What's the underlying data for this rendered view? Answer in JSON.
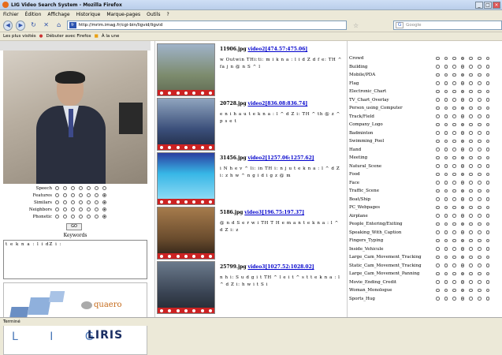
{
  "window": {
    "title": "LIG Video Search System - Mozilla Firefox"
  },
  "menu": [
    "Fichier",
    "Édition",
    "Affichage",
    "Historique",
    "Marque-pages",
    "Outils",
    "?"
  ],
  "nav": {
    "url": "http://mrim.imag.fr/cgi-bin/ligvid/ligvid",
    "search_placeholder": "Google"
  },
  "bookmarks": [
    "Les plus visités",
    "Débuter avec Firefox",
    "À la une"
  ],
  "left": {
    "modes": [
      {
        "label": "Speech",
        "sel": -1
      },
      {
        "label": "Features",
        "sel": 6
      },
      {
        "label": "Similars",
        "sel": 6
      },
      {
        "label": "Neighbors",
        "sel": 6
      },
      {
        "label": "Phonetic",
        "sel": 6
      }
    ],
    "go": "GO",
    "keywords_label": "Keywords",
    "keywords_value": "t e k n a : l i dZ i :",
    "logos": {
      "lig": "L I G",
      "quaero": "quaero",
      "liris": "LIRIS"
    }
  },
  "results": [
    {
      "file": "11906.jpg",
      "link": "video2[474.57:475.06]",
      "phon": "w Outwin THi:ti: m i k n a : l i d Z d f e: TH ^ fa j n @ n S ^ l"
    },
    {
      "file": "20728.jpg",
      "link": "video2[836.08:836.74]",
      "phon": "e n i h a u t e k n a : l ^ d Z i: TH ^ th @ z ^ p s e t"
    },
    {
      "file": "31456.jpg",
      "link": "video2[1257.06:1257.62]",
      "phon": "i N h e v ^ li: in TH i: n j u t e k n a : l ^ d Z i: z h w ^ n g i d i g z @ m"
    },
    {
      "file": "5186.jpg",
      "link": "video3[196.75:197.37]",
      "phon": "@ n d S e r w i TH T H e m a n t e k n a : l ^ d Z i: z"
    },
    {
      "file": "25799.jpg",
      "link": "video3[1027.52:1028.02]",
      "phon": "n h i: S u d g i t TH ^ l e i t ^ s t t e k n a : l ^ d Z i: h w i t S i"
    }
  ],
  "concepts": [
    {
      "name": "Crowd",
      "sel": 3
    },
    {
      "name": "Building",
      "sel": 3
    },
    {
      "name": "Mobile/PDA",
      "sel": 3
    },
    {
      "name": "Flag",
      "sel": 3
    },
    {
      "name": "Electronic_Chart",
      "sel": 3
    },
    {
      "name": "TV_Chart_Overlay",
      "sel": 3
    },
    {
      "name": "Person_using_Computer",
      "sel": 3
    },
    {
      "name": "Track/Field",
      "sel": 3
    },
    {
      "name": "Company_Logo",
      "sel": 3
    },
    {
      "name": "Badminton",
      "sel": 3
    },
    {
      "name": "Swimming_Pool",
      "sel": 3
    },
    {
      "name": "Hand",
      "sel": 3
    },
    {
      "name": "Meeting",
      "sel": 3
    },
    {
      "name": "Natural_Scene",
      "sel": 3
    },
    {
      "name": "Food",
      "sel": 3
    },
    {
      "name": "Face",
      "sel": 3
    },
    {
      "name": "Traffic_Scene",
      "sel": 3
    },
    {
      "name": "Boat/Ship",
      "sel": 3
    },
    {
      "name": "PC_Webpages",
      "sel": 3
    },
    {
      "name": "Airplane",
      "sel": 3
    },
    {
      "name": "People_Entering/Exiting",
      "sel": 3
    },
    {
      "name": "Speaking_With_Caption",
      "sel": 3
    },
    {
      "name": "Fingers_Typing",
      "sel": 3
    },
    {
      "name": "Inside_Vehicule",
      "sel": 3
    },
    {
      "name": "Large_Cam_Movement_Tracking",
      "sel": 3
    },
    {
      "name": "Static_Cam_Movement_Tracking",
      "sel": 3
    },
    {
      "name": "Large_Cam_Movement_Panning",
      "sel": 3
    },
    {
      "name": "Movie_Ending_Credit",
      "sel": 3
    },
    {
      "name": "Woman_Monologue",
      "sel": 3
    },
    {
      "name": "Sports_Hug",
      "sel": 3
    }
  ],
  "status": "Terminé"
}
